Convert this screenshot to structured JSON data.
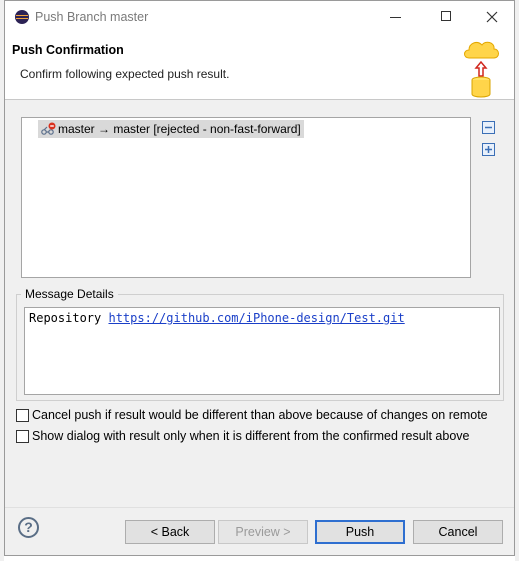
{
  "window": {
    "title": "Push Branch master",
    "controls": {
      "minimize": "minimize",
      "maximize": "maximize",
      "close": "close"
    }
  },
  "header": {
    "title": "Push Confirmation",
    "description": "Confirm following expected push result.",
    "graphic_icon": "push-to-repository-icon"
  },
  "results": {
    "rows": [
      {
        "label": "master → master [rejected - non-fast-forward]",
        "icon": "rejected-branch-icon"
      }
    ],
    "side_buttons": {
      "collapse": "collapse-all-icon",
      "expand": "expand-all-icon"
    }
  },
  "message_details": {
    "label": "Message Details",
    "prefix": "Repository ",
    "url": "https://github.com/iPhone-design/Test.git"
  },
  "options": [
    {
      "label": "Cancel push if result would be different than above because of changes on remote",
      "checked": false
    },
    {
      "label": "Show dialog with result only when it is different from the confirmed result above",
      "checked": false
    }
  ],
  "footer": {
    "help_icon": "?",
    "back_label": "< Back",
    "preview_label": "Preview >",
    "push_label": "Push",
    "cancel_label": "Cancel"
  }
}
